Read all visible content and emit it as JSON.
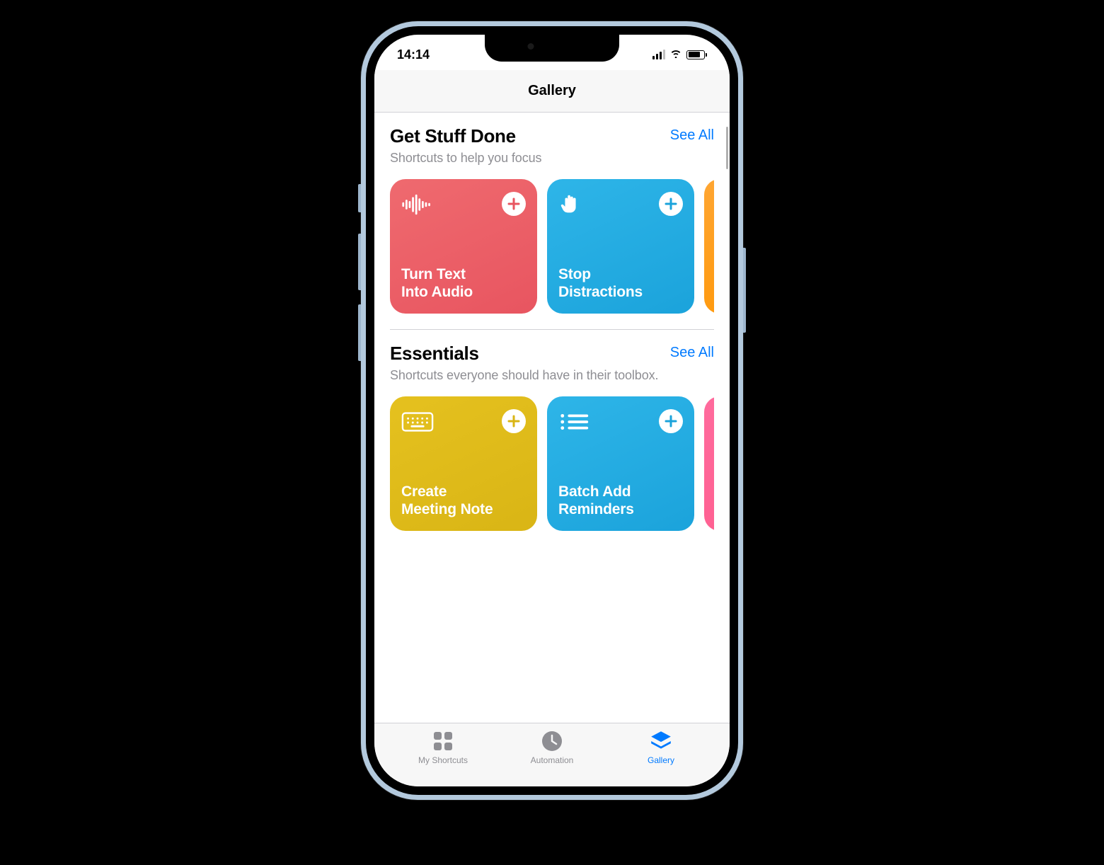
{
  "status_bar": {
    "time": "14:14"
  },
  "nav": {
    "title": "Gallery"
  },
  "sections": [
    {
      "title": "Get Stuff Done",
      "subtitle": "Shortcuts to help you focus",
      "see_all": "See All",
      "cards": [
        {
          "label": "Turn Text\nInto Audio",
          "icon": "waveform",
          "color": "red"
        },
        {
          "label": "Stop\nDistractions",
          "icon": "hand",
          "color": "blue"
        },
        {
          "label": "",
          "icon": "",
          "color": "orange"
        }
      ]
    },
    {
      "title": "Essentials",
      "subtitle": "Shortcuts everyone should have in their toolbox.",
      "see_all": "See All",
      "cards": [
        {
          "label": "Create\nMeeting Note",
          "icon": "keyboard",
          "color": "yellow"
        },
        {
          "label": "Batch Add\nReminders",
          "icon": "list",
          "color": "blue"
        },
        {
          "label": "",
          "icon": "",
          "color": "pink"
        }
      ]
    }
  ],
  "tabs": {
    "items": [
      {
        "label": "My Shortcuts",
        "icon": "grid",
        "active": false
      },
      {
        "label": "Automation",
        "icon": "clock",
        "active": false
      },
      {
        "label": "Gallery",
        "icon": "stack",
        "active": true
      }
    ]
  },
  "colors": {
    "accent": "#007AFF",
    "red": "#e85560",
    "blue": "#1ba3db",
    "orange": "#ff9500",
    "yellow": "#d9b515",
    "pink": "#ff5c8d"
  }
}
